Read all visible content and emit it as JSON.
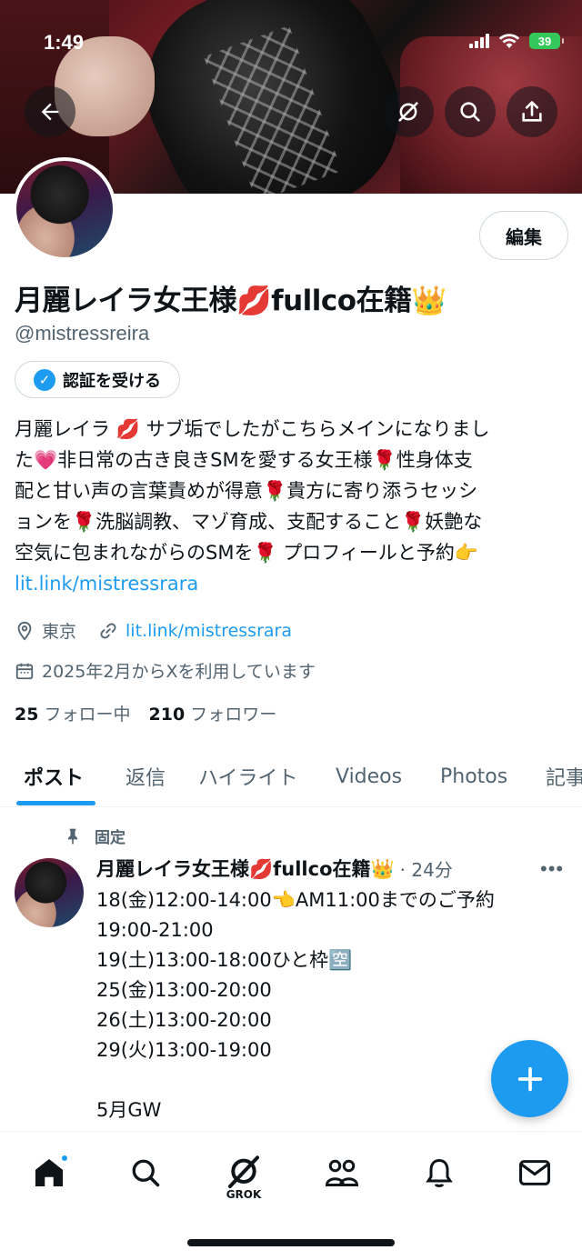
{
  "status_bar": {
    "time": "1:49",
    "battery": "39"
  },
  "header": {
    "back_icon": "arrow-left-icon",
    "grok_icon": "grok-icon",
    "search_icon": "search-icon",
    "share_icon": "share-icon"
  },
  "profile": {
    "display_name": "月麗レイラ女王様💋fullco在籍👑",
    "handle": "@mistressreira",
    "edit_label": "編集",
    "verify_label": "認証を受ける",
    "bio_lines": [
      "月麗レイラ 💋 サブ垢でしたがこちらメインになりまし",
      "た💗非日常の古き良きSMを愛する女王様🌹性身体支",
      "配と甘い声の言葉責めが得意🌹貴方に寄り添うセッシ",
      "ョンを🌹洗脳調教、マゾ育成、支配すること🌹妖艶な",
      "空気に包まれながらのSMを🌹 プロフィールと予約👉"
    ],
    "bio_link": "lit.link/mistressrara",
    "location": "東京",
    "website": "lit.link/mistressrara",
    "joined": "2025年2月からXを利用しています",
    "following_count": "25",
    "following_label": "フォロー中",
    "followers_count": "210",
    "followers_label": "フォロワー"
  },
  "tabs": [
    "ポスト",
    "返信",
    "ハイライト",
    "Videos",
    "Photos",
    "記事"
  ],
  "pinned_post": {
    "pinned_label": "固定",
    "author": "月麗レイラ女王様💋fullco在籍👑",
    "time": "· 24分",
    "lines": [
      "18(金)12:00-14:00👈AM11:00までのご予約",
      "19:00-21:00",
      "19(土)13:00-18:00ひと枠🈳",
      "25(金)13:00-20:00",
      "26(土)13:00-20:00",
      "29(火)13:00-19:00",
      "",
      "5月GW"
    ]
  },
  "bottom_nav": {
    "items": [
      "home-icon",
      "search-icon",
      "grok-icon",
      "communities-icon",
      "notifications-icon",
      "messages-icon"
    ],
    "grok_label": "GROK"
  },
  "colors": {
    "accent": "#1d9bf0",
    "text": "#0f1419",
    "secondary": "#536471"
  }
}
